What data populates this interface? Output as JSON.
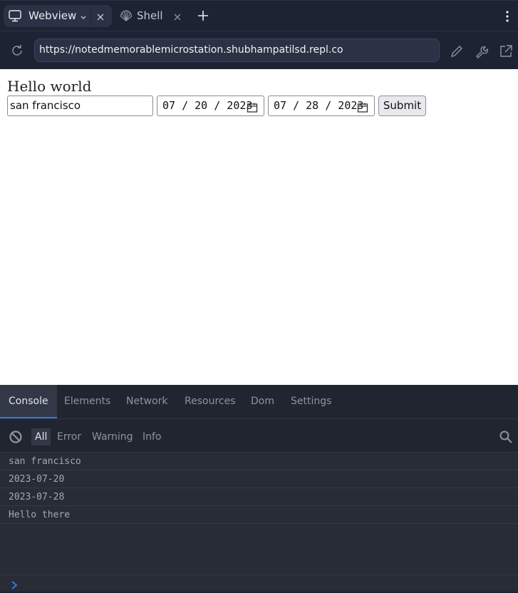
{
  "tabbar": {
    "tabs": [
      {
        "label": "Webview",
        "icon": "monitor-icon",
        "active": true
      },
      {
        "label": "Shell",
        "icon": "shell-icon",
        "active": false
      }
    ]
  },
  "urlbar": {
    "url": "https://notedmemorablemicrostation.shubhampatilsd.repl.co"
  },
  "webview": {
    "heading": "Hello world",
    "city_value": "san francisco",
    "start_date": "07 / 20 / 2023",
    "end_date": "07 / 28 / 2023",
    "submit_label": "Submit"
  },
  "devtools": {
    "tabs": [
      "Console",
      "Elements",
      "Network",
      "Resources",
      "Dom",
      "Settings"
    ],
    "active_tab": "Console",
    "filters": [
      "All",
      "Error",
      "Warning",
      "Info"
    ],
    "active_filter": "All",
    "logs": [
      "san francisco",
      "2023-07-20",
      "2023-07-28",
      "Hello there"
    ]
  },
  "colors": {
    "accent": "#2c7be5",
    "chrome_bg": "#1c2333",
    "devtools_bg": "#21252f"
  }
}
